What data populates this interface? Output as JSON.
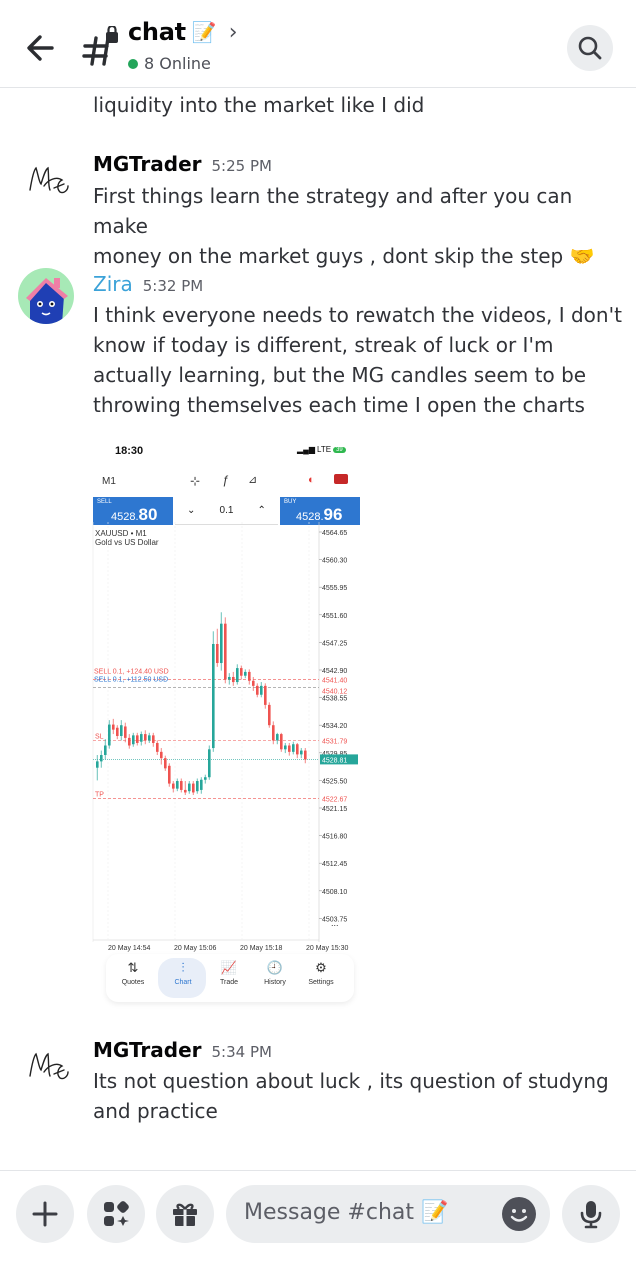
{
  "header": {
    "title": "chat",
    "title_emoji": "📝",
    "online_text": "8 Online"
  },
  "messages": [
    {
      "text": "liquidity into the market like I did"
    },
    {
      "author": "MGTrader",
      "time": "5:25 PM",
      "lines": [
        "First things learn the strategy and after you can make",
        "money on the market guys , dont skip the step 🤝"
      ]
    },
    {
      "author": "Zira",
      "time": "5:32 PM",
      "lines": [
        "I think everyone needs to rewatch the videos, I don't",
        "know if today is different, streak of luck or I'm",
        "actually learning, but the MG candles seem to be",
        "throwing themselves each time I open the charts"
      ]
    },
    {
      "author": "MGTrader",
      "time": "5:34 PM",
      "lines": [
        "Its not question about luck , its question of studyng",
        "and practice"
      ]
    }
  ],
  "attachment": {
    "status_time": "18:30",
    "status_net": "LTE",
    "status_battery": "39",
    "timeframe": "M1",
    "sell_label": "SELL",
    "sell_price_main": "4528.",
    "sell_price_big": "80",
    "buy_label": "BUY",
    "buy_price_main": "4528.",
    "buy_price_big": "96",
    "qty": "0.1",
    "symbol": "XAUUSD • M1",
    "symbol_desc": "Gold vs US Dollar",
    "order1": "SELL 0.1, +124.40 USD",
    "order2": "SELL 0.1, +112.50 USD",
    "sl": "SL",
    "tp": "TP",
    "price_labels": [
      "4564.65",
      "4560.30",
      "4555.95",
      "4551.60",
      "4547.25",
      "4542.90",
      "4538.55",
      "4534.20",
      "4529.85",
      "4525.50",
      "4521.15",
      "4516.80",
      "4512.45",
      "4508.10",
      "4503.75"
    ],
    "highlight_labels": {
      "red1": "4541.40",
      "red2": "4540.12",
      "sl_price": "4531.79",
      "current": "4528.81",
      "tp_price": "4522.67"
    },
    "more_label": "...",
    "time_labels": [
      "20 May 14:54",
      "20 May 15:06",
      "20 May 15:18",
      "20 May 15:30"
    ],
    "nav": [
      {
        "label": "Quotes",
        "icon": "⇅"
      },
      {
        "label": "Chart",
        "icon": "⫶"
      },
      {
        "label": "Trade",
        "icon": "📈"
      },
      {
        "label": "History",
        "icon": "🕘"
      },
      {
        "label": "Settings",
        "icon": "⚙"
      }
    ],
    "colors": {
      "up": "#26a69a",
      "down": "#ef5350",
      "accent": "#2e77d0"
    }
  },
  "composer": {
    "placeholder": "Message #chat 📝"
  }
}
